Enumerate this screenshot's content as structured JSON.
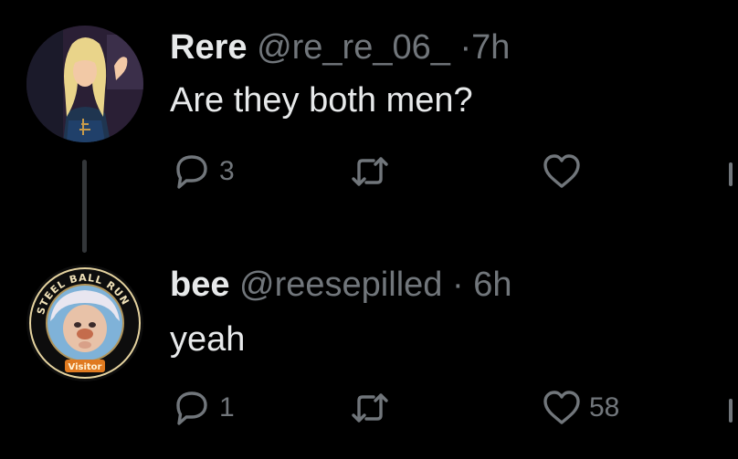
{
  "thread": {
    "tweets": [
      {
        "name": "Rere",
        "handle": "@re_re_06_",
        "separator": "·",
        "time": "7h",
        "text": "Are they both men?",
        "reply_count": "3",
        "retweet_count": "",
        "like_count": "",
        "avatar_icon": "anime-avatar-blonde"
      },
      {
        "name": "bee",
        "handle": "@reesepilled",
        "separator": "·",
        "time": "6h",
        "text": "yeah",
        "reply_count": "1",
        "retweet_count": "",
        "like_count": "58",
        "avatar_icon": "steel-ball-run-badge-avatar",
        "avatar_badge_top": "STEEL BALL RUN",
        "avatar_badge_bottom": "Visitor"
      }
    ]
  },
  "icons": {
    "reply": "reply-bubble-icon",
    "retweet": "retweet-icon",
    "like": "heart-icon",
    "share": "share-icon"
  },
  "colors": {
    "background": "#000000",
    "primary_text": "#e7e9ea",
    "secondary_text": "#71767b",
    "thread_line": "#333639"
  }
}
